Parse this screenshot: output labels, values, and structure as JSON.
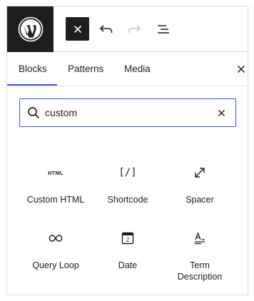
{
  "tabs": [
    {
      "label": "Blocks",
      "active": true
    },
    {
      "label": "Patterns",
      "active": false
    },
    {
      "label": "Media",
      "active": false
    }
  ],
  "search": {
    "value": "custom",
    "placeholder": "Search"
  },
  "blocks": [
    {
      "label": "Custom HTML",
      "icon": "html-icon",
      "icon_text": "HTML"
    },
    {
      "label": "Shortcode",
      "icon": "shortcode-icon",
      "icon_text": "[/]"
    },
    {
      "label": "Spacer",
      "icon": "spacer-icon"
    },
    {
      "label": "Query Loop",
      "icon": "loop-icon"
    },
    {
      "label": "Date",
      "icon": "calendar-icon",
      "icon_text": "2"
    },
    {
      "label": "Term\nDescription",
      "icon": "term-description-icon"
    }
  ],
  "colors": {
    "accent": "#3858e9",
    "dark": "#1e1e1e",
    "border": "#e0e0e0"
  }
}
